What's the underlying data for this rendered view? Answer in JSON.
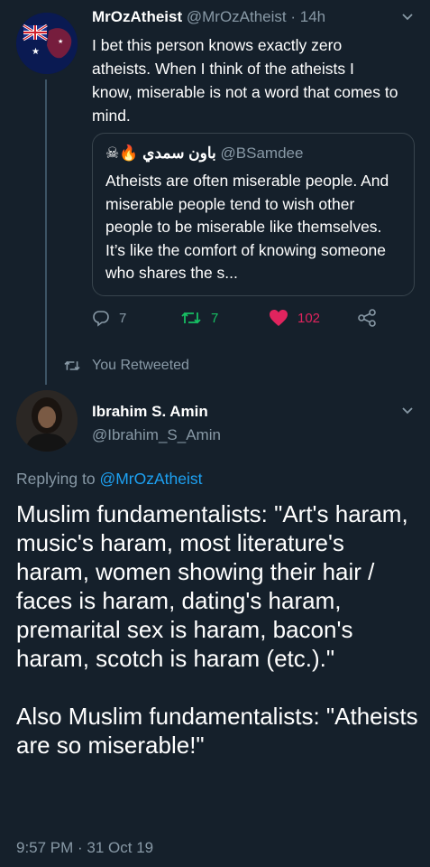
{
  "tweet1": {
    "name": "MrOzAtheist",
    "handle": "@MrOzAtheist",
    "time": "· 14h",
    "text": "I bet this person knows exactly zero atheists. When I think of the atheists I know, miserable is not a word that comes to mind.",
    "quoted": {
      "emoji": "☠🔥",
      "name": "باون سمدي",
      "handle": "@BSamdee",
      "text": "Atheists are often miserable people. And miserable people tend to wish other people to be miserable like themselves. It’s like the comfort of knowing someone who shares the s..."
    },
    "actions": {
      "replies": "7",
      "retweets": "7",
      "likes": "102"
    }
  },
  "retweet_notice": "You Retweeted",
  "tweet2": {
    "name": "Ibrahim S. Amin",
    "handle": "@Ibrahim_S_Amin",
    "replying_prefix": "Replying to",
    "replying_to": "@MrOzAtheist",
    "text": "Muslim fundamentalists: \"Art's haram, music's haram, most literature's haram, women showing their hair / faces is haram, dating's haram, premarital sex is haram, bacon's haram, scotch is haram (etc.).\"\n\nAlso Muslim fundamentalists: \"Atheists are so miserable!\"",
    "timestamp": "9:57 PM · 31 Oct 19"
  },
  "colors": {
    "background": "#15202b",
    "muted": "#8899a6",
    "link": "#1da1f2",
    "retweet": "#17bf63",
    "like": "#e0245e"
  }
}
